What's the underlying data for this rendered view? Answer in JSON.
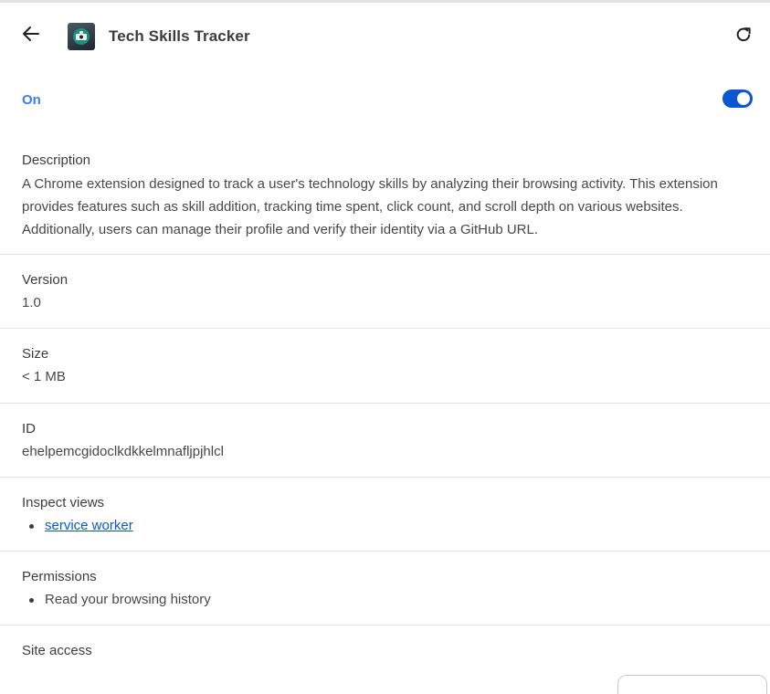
{
  "header": {
    "title": "Tech Skills Tracker",
    "back_icon": "arrow-left-icon",
    "reload_icon": "reload-icon"
  },
  "toggle": {
    "label": "On",
    "enabled": true,
    "color": "#0b57d0"
  },
  "description": {
    "label": "Description",
    "text": "A Chrome extension designed to track a user's technology skills by analyzing their browsing activity. This extension provides features such as skill addition, tracking time spent, click count, and scroll depth on various websites. Additionally, users can manage their profile and verify their identity via a GitHub URL."
  },
  "version": {
    "label": "Version",
    "value": "1.0"
  },
  "size": {
    "label": "Size",
    "value": "< 1 MB"
  },
  "id": {
    "label": "ID",
    "value": "ehelpemcgidoclkdkkelmnafljpjhlcl"
  },
  "inspect_views": {
    "label": "Inspect views",
    "items": [
      "service worker"
    ]
  },
  "permissions": {
    "label": "Permissions",
    "items": [
      "Read your browsing history"
    ]
  },
  "site_access": {
    "label": "Site access"
  }
}
